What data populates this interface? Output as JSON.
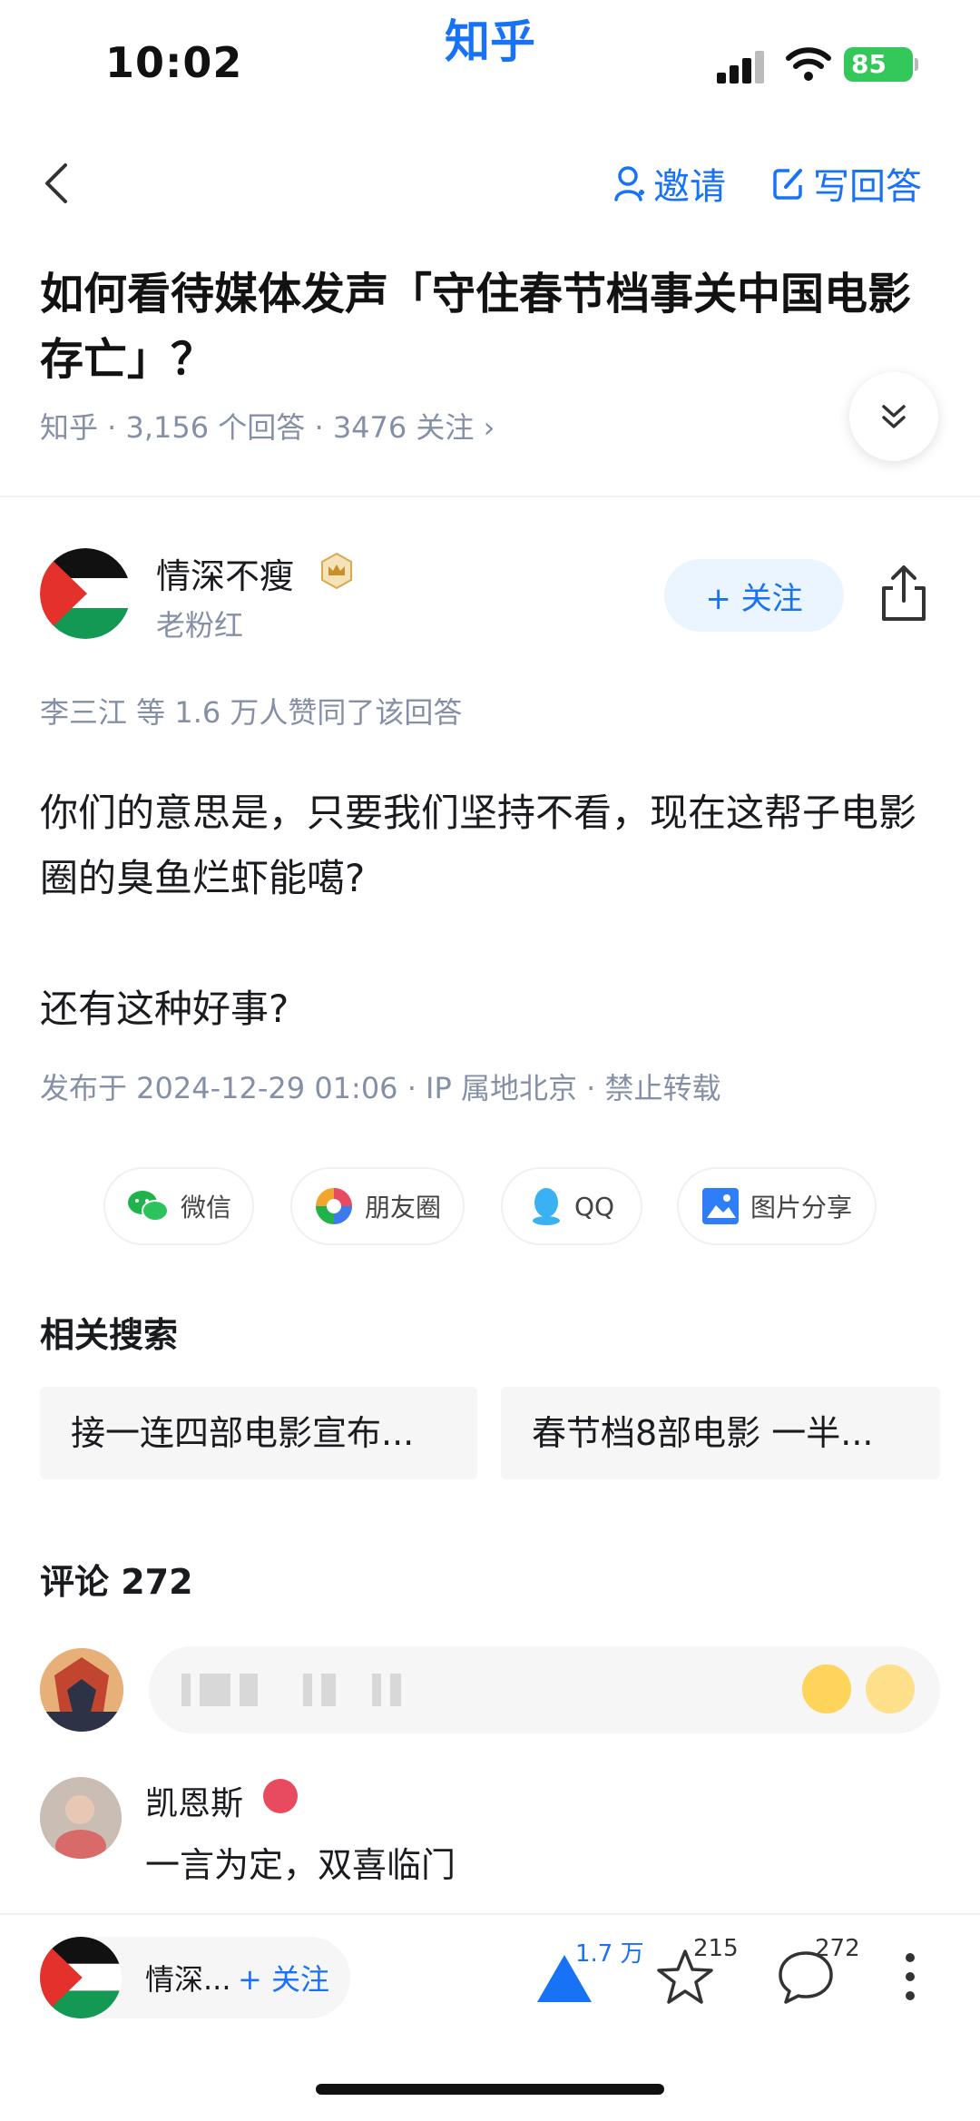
{
  "status": {
    "time": "10:02",
    "battery": "85"
  },
  "app": {
    "brand": "知乎"
  },
  "nav": {
    "invite_label": "邀请",
    "write_label": "写回答"
  },
  "question": {
    "title": "如何看待媒体发声「守住春节档事关中国电影存亡」？",
    "meta": "知乎 · 3,156 个回答 · 3476 关注 ›"
  },
  "author": {
    "name": "情深不瘦",
    "bio": "老粉红",
    "follow_label": "+ 关注"
  },
  "answer": {
    "upvoters": "李三江 等 1.6 万人赞同了该回答",
    "paragraphs": [
      "你们的意思是，只要我们坚持不看，现在这帮子电影圈的臭鱼烂虾能噶?",
      "还有这种好事?"
    ],
    "publish_info": "发布于 2024-12-29 01:06 · IP 属地北京 · 禁止转载"
  },
  "share": {
    "wechat": "微信",
    "moments": "朋友圈",
    "qq": "QQ",
    "image": "图片分享"
  },
  "related": {
    "title": "相关搜索",
    "items": [
      "接一连四部电影宣布...",
      "春节档8部电影 一半..."
    ]
  },
  "comments": {
    "title": "评论 272",
    "items": [
      {
        "name": "凯恩斯",
        "text": "一言为定，双喜临门"
      }
    ]
  },
  "bottom_bar": {
    "author_short": "情深...",
    "follow_label": "+ 关注",
    "vote_count": "1.7 万",
    "fav_count": "215",
    "comment_count": "272"
  },
  "colors": {
    "accent": "#1772f6",
    "muted": "#8590a6",
    "battery": "#34c759"
  }
}
